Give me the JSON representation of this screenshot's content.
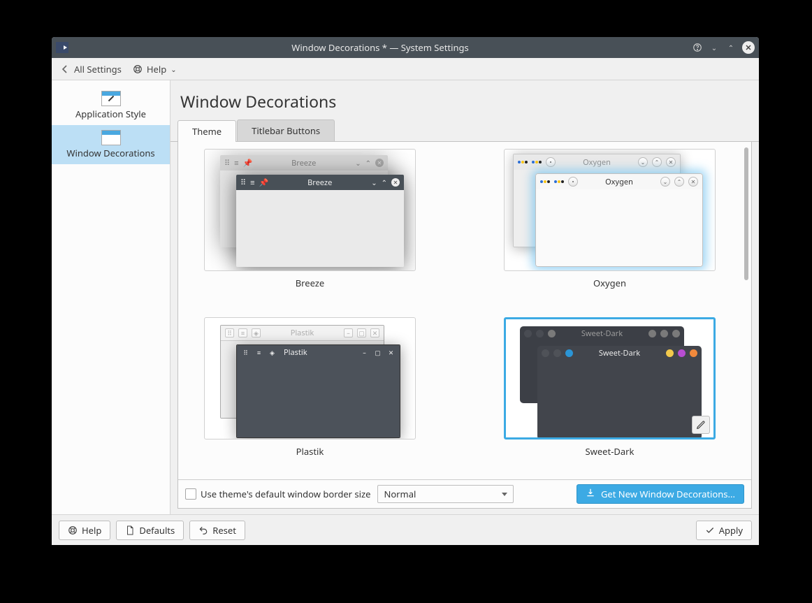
{
  "titlebar": {
    "title": "Window Decorations * — System Settings"
  },
  "toolbar": {
    "all_settings": "All Settings",
    "help": "Help"
  },
  "sidebar": {
    "items": [
      {
        "label": "Application Style"
      },
      {
        "label": "Window Decorations"
      }
    ]
  },
  "page": {
    "title": "Window Decorations"
  },
  "tabs": {
    "theme": "Theme",
    "titlebar_buttons": "Titlebar Buttons"
  },
  "themes": [
    {
      "name": "Breeze",
      "mini_title": "Breeze"
    },
    {
      "name": "Oxygen",
      "mini_title": "Oxygen"
    },
    {
      "name": "Plastik",
      "mini_title": "Plastik"
    },
    {
      "name": "Sweet-Dark",
      "mini_title": "Sweet-Dark"
    }
  ],
  "options": {
    "use_default_border": "Use theme's default window border size",
    "border_size_value": "Normal",
    "get_new": "Get New Window Decorations..."
  },
  "footer": {
    "help": "Help",
    "defaults": "Defaults",
    "reset": "Reset",
    "apply": "Apply"
  }
}
